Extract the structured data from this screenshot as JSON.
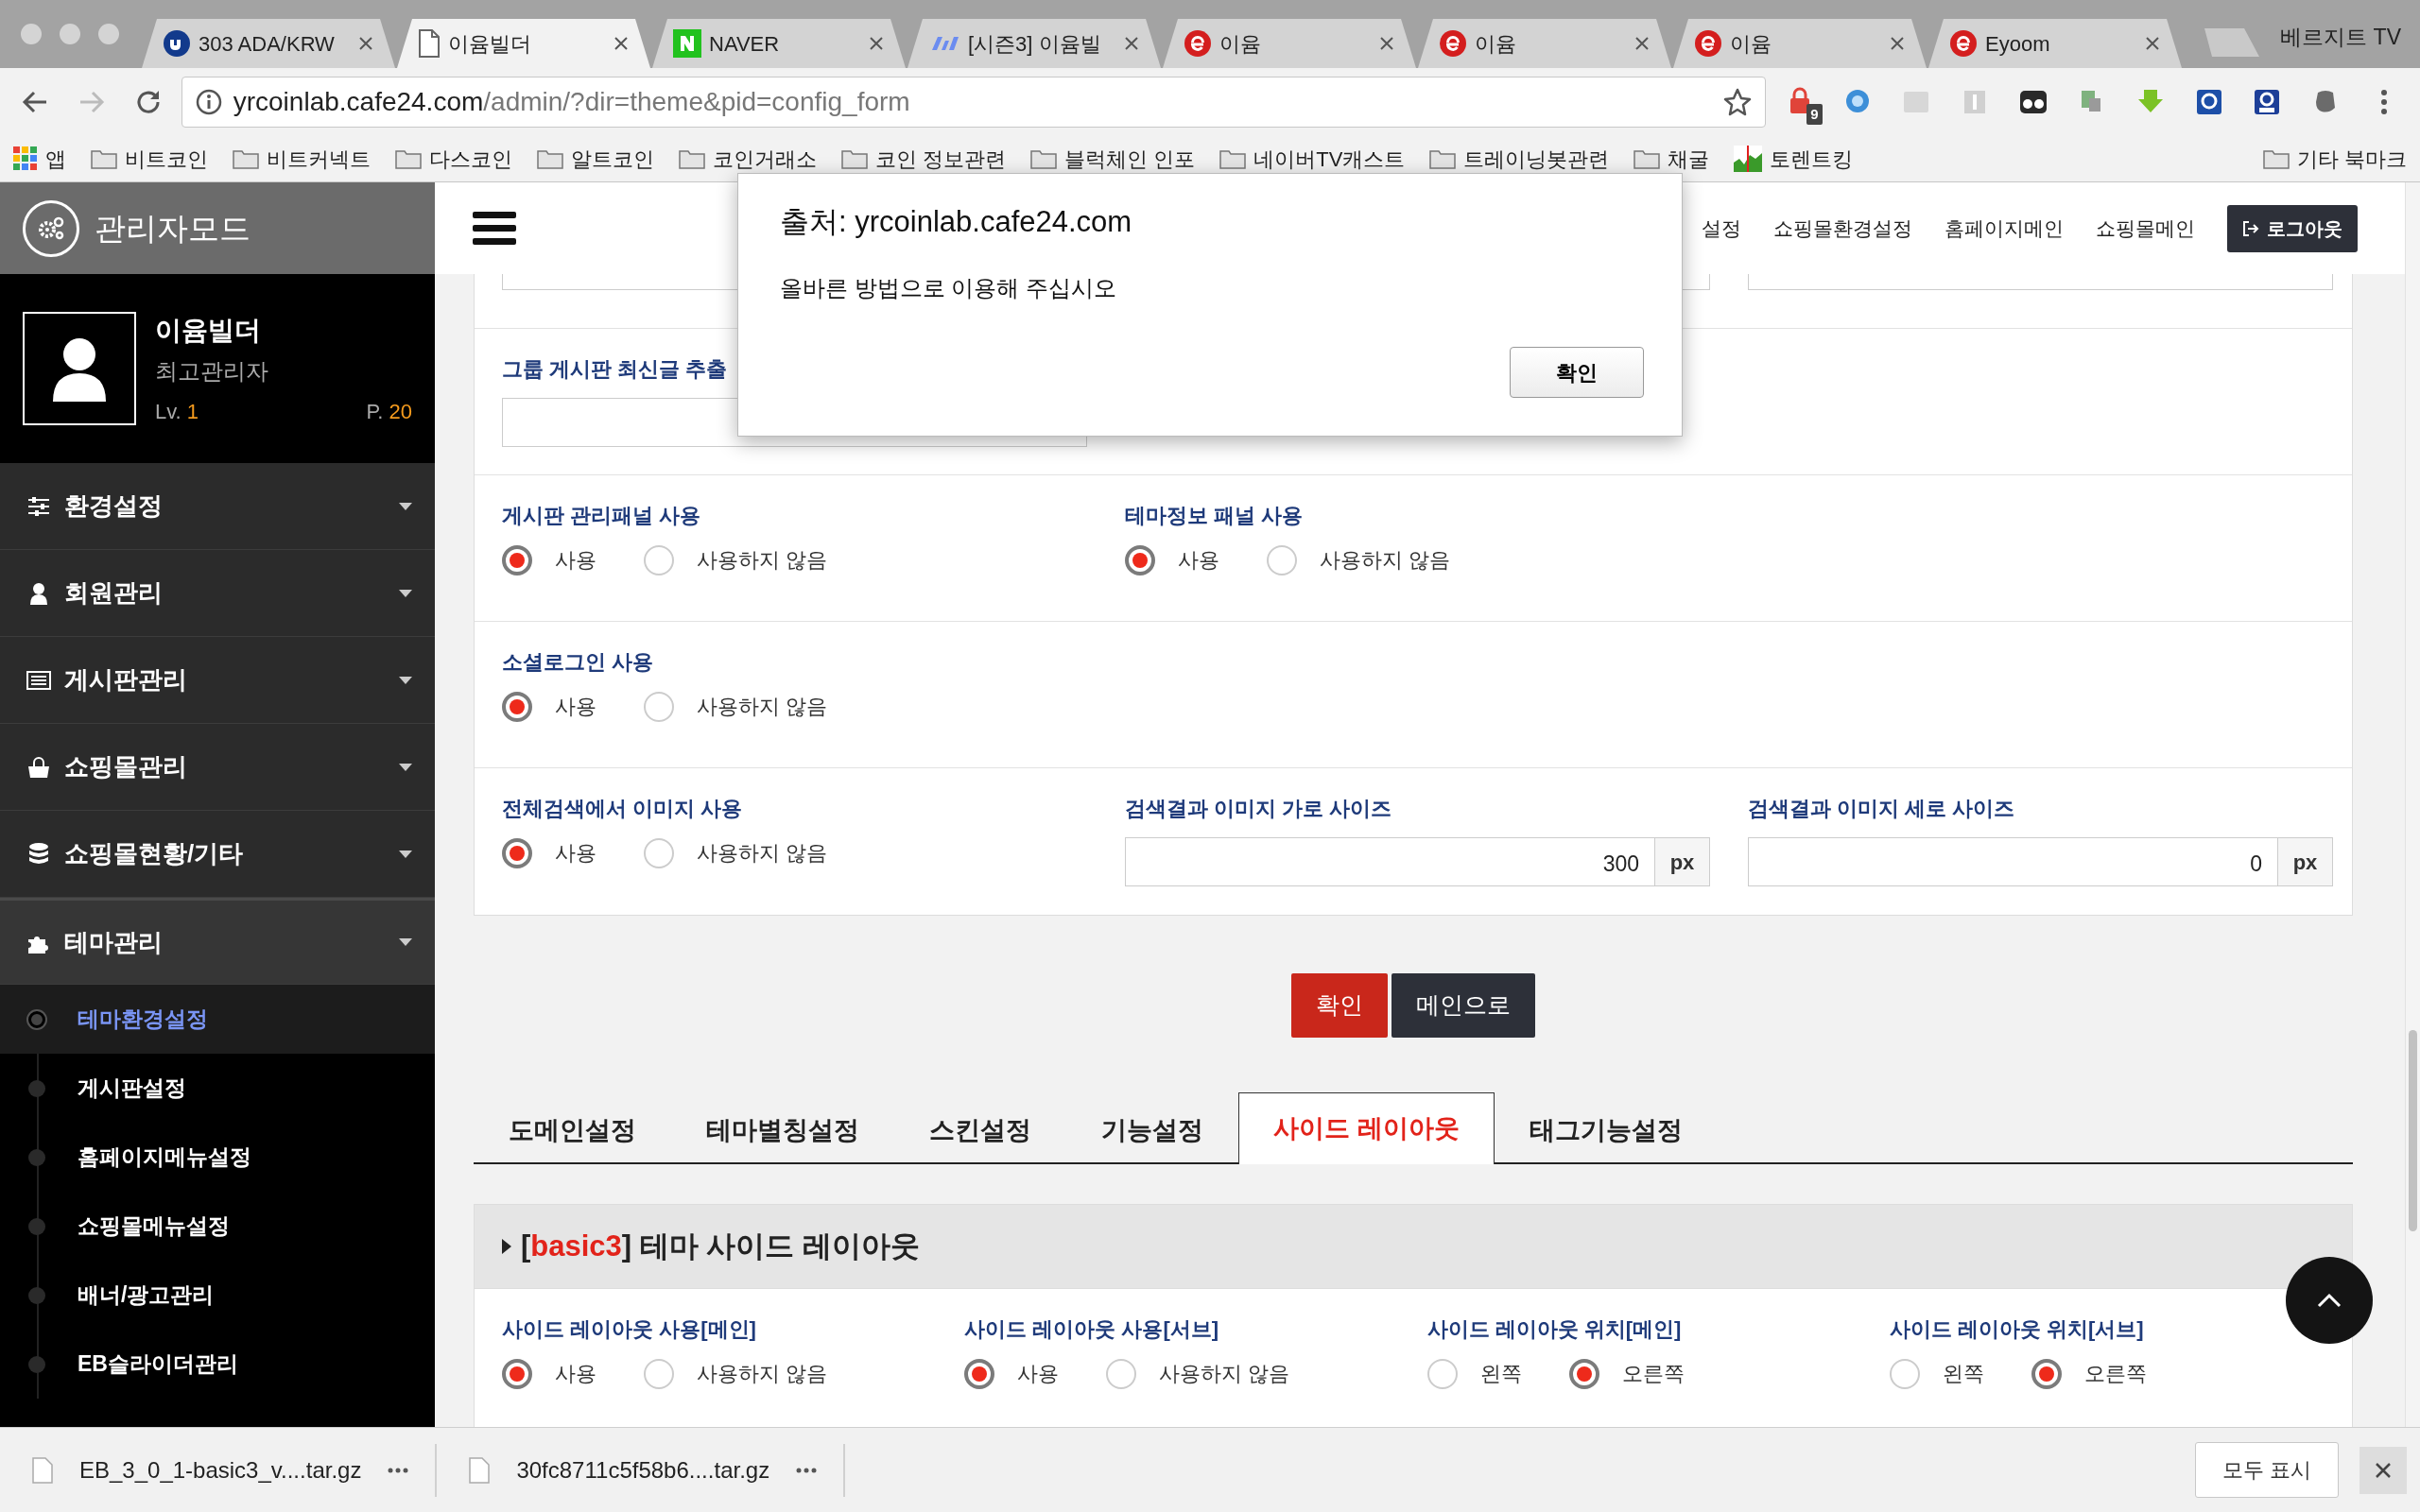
{
  "browser": {
    "tabs": [
      {
        "label": "303 ADA/KRW",
        "selected": false
      },
      {
        "label": "이윰빌더",
        "selected": true
      },
      {
        "label": "NAVER",
        "selected": false
      },
      {
        "label": "[시즌3] 이윰빌",
        "selected": false
      },
      {
        "label": "이윰",
        "selected": false
      },
      {
        "label": "이윰",
        "selected": false
      },
      {
        "label": "이윰",
        "selected": false
      },
      {
        "label": "Eyoom",
        "selected": false
      }
    ],
    "profile": "베르지트 TV",
    "address": {
      "host": "yrcoinlab.cafe24.com",
      "path": "/admin/?dir=theme&pid=config_form"
    },
    "extension_badges": [
      "9"
    ],
    "bookmarks": [
      {
        "kind": "apps",
        "label": "앱"
      },
      {
        "kind": "folder",
        "label": "비트코인"
      },
      {
        "kind": "folder",
        "label": "비트커넥트"
      },
      {
        "kind": "folder",
        "label": "다스코인"
      },
      {
        "kind": "folder",
        "label": "알트코인"
      },
      {
        "kind": "folder",
        "label": "코인거래소"
      },
      {
        "kind": "folder",
        "label": "코인 정보관련"
      },
      {
        "kind": "folder",
        "label": "블럭체인 인포"
      },
      {
        "kind": "folder",
        "label": "네이버TV캐스트"
      },
      {
        "kind": "folder",
        "label": "트레이닝봇관련"
      },
      {
        "kind": "folder",
        "label": "채굴"
      },
      {
        "kind": "site",
        "label": "토렌트킹"
      }
    ],
    "other_bookmarks": "기타 북마크"
  },
  "sidebar": {
    "title": "관리자모드",
    "profile": {
      "name": "이윰빌더",
      "role": "최고관리자",
      "level_label": "Lv.",
      "level": "1",
      "points_label": "P.",
      "points": "20"
    },
    "menu": [
      {
        "label": "환경설정",
        "expanded": false
      },
      {
        "label": "회원관리",
        "expanded": false
      },
      {
        "label": "게시판관리",
        "expanded": false
      },
      {
        "label": "쇼핑몰관리",
        "expanded": false
      },
      {
        "label": "쇼핑몰현황/기타",
        "expanded": false
      },
      {
        "label": "테마관리",
        "expanded": true,
        "children": [
          {
            "label": "테마환경설정",
            "selected": true
          },
          {
            "label": "게시판설정",
            "selected": false
          },
          {
            "label": "홈페이지메뉴설정",
            "selected": false
          },
          {
            "label": "쇼핑몰메뉴설정",
            "selected": false
          },
          {
            "label": "배너/광고관리",
            "selected": false
          },
          {
            "label": "EB슬라이더관리",
            "selected": false
          }
        ]
      }
    ]
  },
  "header": {
    "nav": [
      "설정",
      "쇼핑몰환경설정",
      "홈페이지메인",
      "쇼핑몰메인"
    ],
    "logout": "로그아웃"
  },
  "settings_panel": {
    "rows": [
      {
        "fields": [
          {
            "kind": "cut_input"
          },
          {
            "kind": "cut_input"
          }
        ]
      },
      {
        "fields": [
          {
            "kind": "text",
            "label": "그룹 게시판 최신글 추출"
          }
        ]
      },
      {
        "fields": [
          {
            "kind": "radio",
            "label": "게시판 관리패널 사용",
            "options": [
              {
                "label": "사용",
                "selected": true
              },
              {
                "label": "사용하지 않음",
                "selected": false
              }
            ]
          },
          {
            "kind": "radio",
            "label": "테마정보 패널 사용",
            "options": [
              {
                "label": "사용",
                "selected": true
              },
              {
                "label": "사용하지 않음",
                "selected": false
              }
            ]
          }
        ]
      },
      {
        "fields": [
          {
            "kind": "radio",
            "label": "소셜로그인 사용",
            "options": [
              {
                "label": "사용",
                "selected": true
              },
              {
                "label": "사용하지 않음",
                "selected": false
              }
            ]
          }
        ]
      },
      {
        "fields": [
          {
            "kind": "radio",
            "label": "전체검색에서 이미지 사용",
            "options": [
              {
                "label": "사용",
                "selected": true
              },
              {
                "label": "사용하지 않음",
                "selected": false
              }
            ]
          },
          {
            "kind": "number",
            "label": "검색결과 이미지 가로 사이즈",
            "value": "300",
            "unit": "px"
          },
          {
            "kind": "number",
            "label": "검색결과 이미지 세로 사이즈",
            "value": "0",
            "unit": "px"
          }
        ]
      }
    ]
  },
  "buttons": [
    {
      "label": "확인",
      "kind": "primary"
    },
    {
      "label": "메인으로",
      "kind": "secondary"
    }
  ],
  "section_tabs": [
    {
      "label": "도메인설정",
      "selected": false
    },
    {
      "label": "테마별칭설정",
      "selected": false
    },
    {
      "label": "스킨설정",
      "selected": false
    },
    {
      "label": "기능설정",
      "selected": false
    },
    {
      "label": "사이드 레이아웃",
      "selected": true
    },
    {
      "label": "태그기능설정",
      "selected": false
    }
  ],
  "layout_panel": {
    "title": [
      {
        "kind": "plain",
        "text": "["
      },
      {
        "kind": "highlight",
        "text": "basic3"
      },
      {
        "kind": "plain",
        "text": "] 테마 사이드 레이아웃"
      }
    ],
    "fields": [
      {
        "kind": "radio",
        "label": "사이드 레이아웃 사용[메인]",
        "options": [
          {
            "label": "사용",
            "selected": true
          },
          {
            "label": "사용하지 않음",
            "selected": false
          }
        ]
      },
      {
        "kind": "radio",
        "label": "사이드 레이아웃 사용[서브]",
        "options": [
          {
            "label": "사용",
            "selected": true
          },
          {
            "label": "사용하지 않음",
            "selected": false
          }
        ]
      },
      {
        "kind": "radio",
        "label": "사이드 레이아웃 위치[메인]",
        "options": [
          {
            "label": "왼쪽",
            "selected": false
          },
          {
            "label": "오른쪽",
            "selected": true
          }
        ]
      },
      {
        "kind": "radio",
        "label": "사이드 레이아웃 위치[서브]",
        "options": [
          {
            "label": "왼쪽",
            "selected": false
          },
          {
            "label": "오른쪽",
            "selected": true
          }
        ]
      }
    ]
  },
  "dialog": {
    "title": "출처: yrcoinlab.cafe24.com",
    "message": "올바른 방법으로 이용해 주십시오",
    "button": "확인"
  },
  "downloads": {
    "items": [
      {
        "name": "EB_3_0_1-basic3_v....tar.gz"
      },
      {
        "name": "30fc8711c5f58b6....tar.gz"
      }
    ],
    "show_all": "모두 표시"
  }
}
